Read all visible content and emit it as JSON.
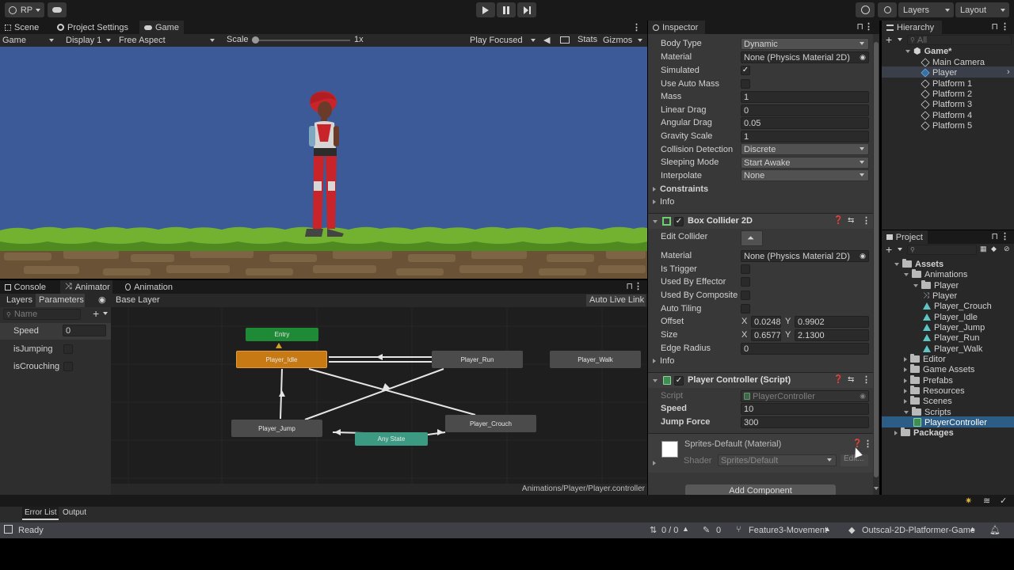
{
  "toolbar": {
    "account_label": "RP",
    "history_icon": "history-icon",
    "search_icon": "search-icon",
    "layers_label": "Layers",
    "layout_label": "Layout"
  },
  "scene_tabs": {
    "tabs": [
      "Scene",
      "Project Settings",
      "Game"
    ],
    "game_mode": "Game",
    "display": "Display 1",
    "aspect": "Free Aspect",
    "scale_label": "Scale",
    "scale_value": "1x",
    "scale_fraction": 0.0,
    "play_mode": "Play Focused",
    "stats": "Stats",
    "gizmos": "Gizmos"
  },
  "game_view": {
    "sky_color": "#3b5a97"
  },
  "bottom_left": {
    "tabs": [
      "Console",
      "Animator",
      "Animation"
    ],
    "layers_tab": "Layers",
    "parameters_tab": "Parameters",
    "base_layer": "Base Layer",
    "auto_live_link": "Auto Live Link",
    "name_placeholder": "Name",
    "parameters": [
      {
        "name": "Speed",
        "value": "0"
      },
      {
        "name": "isJumping"
      },
      {
        "name": "isCrouching"
      }
    ],
    "states": {
      "entry": "Entry",
      "idle": "Player_Idle",
      "run": "Player_Run",
      "walk": "Player_Walk",
      "jump": "Player_Jump",
      "crouch": "Player_Crouch",
      "any": "Any State"
    },
    "controller_path": "Animations/Player/Player.controller"
  },
  "inspector": {
    "tab": "Inspector",
    "rigidbody": {
      "body_type": {
        "label": "Body Type",
        "value": "Dynamic"
      },
      "material": {
        "label": "Material",
        "value": "None (Physics Material 2D)"
      },
      "simulated": {
        "label": "Simulated",
        "checked": true
      },
      "use_auto_mass": {
        "label": "Use Auto Mass"
      },
      "mass": {
        "label": "Mass",
        "value": "1"
      },
      "linear_drag": {
        "label": "Linear Drag",
        "value": "0"
      },
      "angular_drag": {
        "label": "Angular Drag",
        "value": "0.05"
      },
      "gravity_scale": {
        "label": "Gravity Scale",
        "value": "1"
      },
      "collision_detection": {
        "label": "Collision Detection",
        "value": "Discrete"
      },
      "sleeping_mode": {
        "label": "Sleeping Mode",
        "value": "Start Awake"
      },
      "interpolate": {
        "label": "Interpolate",
        "value": "None"
      },
      "constraints": "Constraints",
      "info": "Info"
    },
    "box_collider": {
      "title": "Box Collider 2D",
      "edit_collider": "Edit Collider",
      "material": {
        "label": "Material",
        "value": "None (Physics Material 2D)"
      },
      "is_trigger": "Is Trigger",
      "used_by_effector": "Used By Effector",
      "used_by_composite": "Used By Composite",
      "auto_tiling": "Auto Tiling",
      "offset": {
        "label": "Offset",
        "x": "0.0248",
        "y": "0.9902"
      },
      "size": {
        "label": "Size",
        "x": "0.6577",
        "y": "2.1300"
      },
      "edge_radius": {
        "label": "Edge Radius",
        "value": "0"
      },
      "info": "Info",
      "x_label": "X",
      "y_label": "Y"
    },
    "player_controller": {
      "title": "Player Controller (Script)",
      "script_label": "Script",
      "script_value": "PlayerController",
      "speed": {
        "label": "Speed",
        "value": "10"
      },
      "jump_force": {
        "label": "Jump Force",
        "value": "300"
      }
    },
    "material": {
      "name": "Sprites-Default (Material)",
      "shader_label": "Shader",
      "shader_value": "Sprites/Default",
      "edit": "Edit..."
    },
    "add_component": "Add Component"
  },
  "hierarchy": {
    "tab": "Hierarchy",
    "search_placeholder": "All",
    "scene": "Game*",
    "items": [
      "Main Camera",
      "Player",
      "Platform 1",
      "Platform 2",
      "Platform 3",
      "Platform 4",
      "Platform 5"
    ]
  },
  "project": {
    "tab": "Project",
    "assets": "Assets",
    "animations": "Animations",
    "player_folder": "Player",
    "anim_files": [
      "Player",
      "Player_Crouch",
      "Player_Idle",
      "Player_Jump",
      "Player_Run",
      "Player_Walk"
    ],
    "folders": [
      "Editor",
      "Game Assets",
      "Prefabs",
      "Resources",
      "Scenes"
    ],
    "scripts": "Scripts",
    "script_file": "PlayerController",
    "packages": "Packages"
  },
  "console_bar": {
    "tabs": [
      "Error List",
      "Output"
    ]
  },
  "status_bar": {
    "ready": "Ready",
    "sync": "0 / 0",
    "edits": "0",
    "branch": "Feature3-Movement",
    "repo": "Outscal-2D-Platformer-Game"
  }
}
